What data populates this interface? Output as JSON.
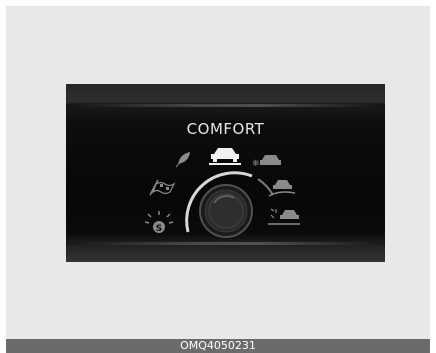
{
  "display": {
    "mode_label": "COMFORT",
    "selected_mode_icon": "comfort-car-icon",
    "mode_icons": [
      "smart-mode-icon",
      "sport-flag-icon",
      "eco-leaf-icon",
      "comfort-car-icon",
      "snow-car-icon",
      "mud-car-icon",
      "sand-car-icon"
    ],
    "knob_icon": "drive-mode-knob-icon"
  },
  "caption": {
    "code": "OMQ4050231"
  },
  "colors": {
    "frame_bg": "#e8e8e8",
    "display_bg": "#0a0a0a",
    "text": "#e6e6e6",
    "icon_dim": "#8a8a8a",
    "caption_bg": "#6b6b6b"
  }
}
